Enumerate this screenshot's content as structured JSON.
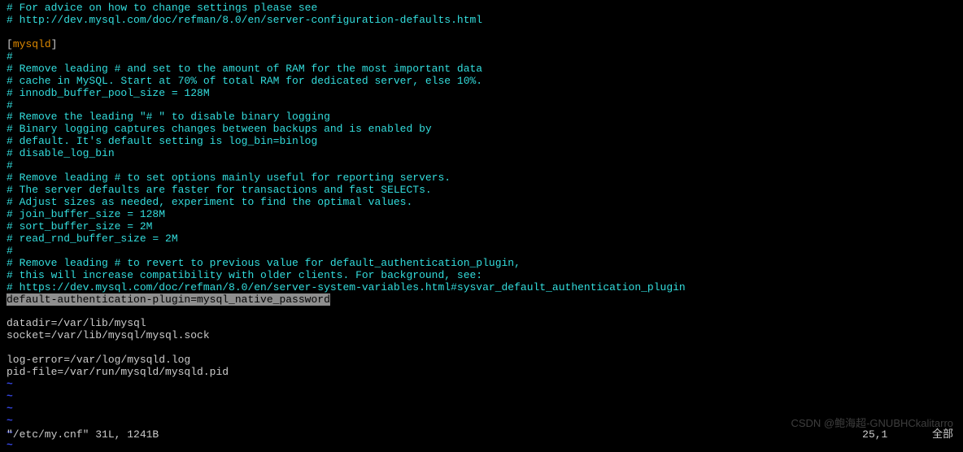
{
  "editor": {
    "lines": [
      {
        "type": "comment",
        "text": "# For advice on how to change settings please see"
      },
      {
        "type": "comment",
        "text": "# http://dev.mysql.com/doc/refman/8.0/en/server-configuration-defaults.html"
      },
      {
        "type": "blank",
        "text": ""
      },
      {
        "type": "section",
        "text": "[mysqld]"
      },
      {
        "type": "comment",
        "text": "#"
      },
      {
        "type": "comment",
        "text": "# Remove leading # and set to the amount of RAM for the most important data"
      },
      {
        "type": "comment",
        "text": "# cache in MySQL. Start at 70% of total RAM for dedicated server, else 10%."
      },
      {
        "type": "comment",
        "text": "# innodb_buffer_pool_size = 128M"
      },
      {
        "type": "comment",
        "text": "#"
      },
      {
        "type": "comment",
        "text": "# Remove the leading \"# \" to disable binary logging"
      },
      {
        "type": "comment",
        "text": "# Binary logging captures changes between backups and is enabled by"
      },
      {
        "type": "comment",
        "text": "# default. It's default setting is log_bin=binlog"
      },
      {
        "type": "comment",
        "text": "# disable_log_bin"
      },
      {
        "type": "comment",
        "text": "#"
      },
      {
        "type": "comment",
        "text": "# Remove leading # to set options mainly useful for reporting servers."
      },
      {
        "type": "comment",
        "text": "# The server defaults are faster for transactions and fast SELECTs."
      },
      {
        "type": "comment",
        "text": "# Adjust sizes as needed, experiment to find the optimal values."
      },
      {
        "type": "comment",
        "text": "# join_buffer_size = 128M"
      },
      {
        "type": "comment",
        "text": "# sort_buffer_size = 2M"
      },
      {
        "type": "comment",
        "text": "# read_rnd_buffer_size = 2M"
      },
      {
        "type": "comment",
        "text": "#"
      },
      {
        "type": "comment",
        "text": "# Remove leading # to revert to previous value for default_authentication_plugin,"
      },
      {
        "type": "comment",
        "text": "# this will increase compatibility with older clients. For background, see:"
      },
      {
        "type": "comment",
        "text": "# https://dev.mysql.com/doc/refman/8.0/en/server-system-variables.html#sysvar_default_authentication_plugin"
      },
      {
        "type": "highlighted",
        "text": "default-authentication-plugin=mysql_native_password"
      },
      {
        "type": "blank",
        "text": ""
      },
      {
        "type": "white",
        "text": "datadir=/var/lib/mysql"
      },
      {
        "type": "white",
        "text": "socket=/var/lib/mysql/mysql.sock"
      },
      {
        "type": "blank",
        "text": ""
      },
      {
        "type": "white",
        "text": "log-error=/var/log/mysqld.log"
      },
      {
        "type": "white",
        "text": "pid-file=/var/run/mysqld/mysqld.pid"
      }
    ],
    "tildes": [
      "~",
      "~",
      "~",
      "~",
      "~",
      "~"
    ],
    "status_left": "\"/etc/my.cnf\" 31L, 1241B",
    "status_cursor": "25,1",
    "status_right": "全部",
    "watermark": "CSDN @鲍海超-GNUBHCkalitarro"
  }
}
